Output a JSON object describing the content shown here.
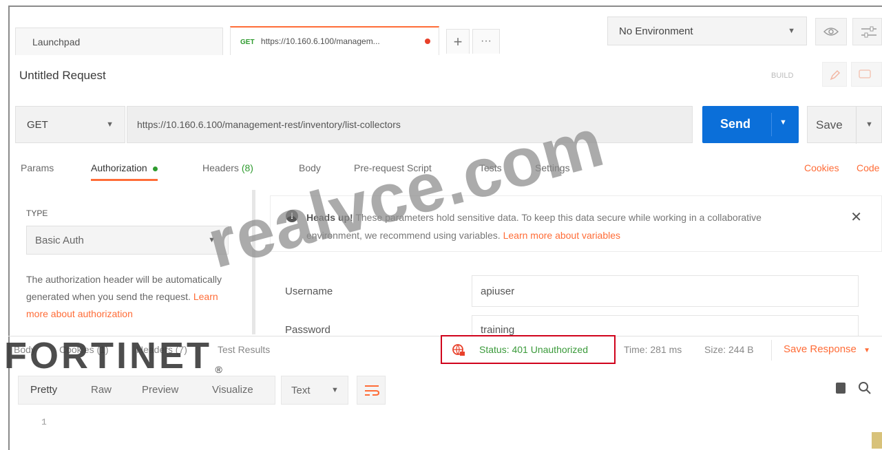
{
  "tabs": {
    "launchpad": "Launchpad",
    "request_method": "GET",
    "request_url": "https://10.160.6.100/managem...",
    "add": "+",
    "more": "···"
  },
  "environment": {
    "selected": "No Environment"
  },
  "request": {
    "title": "Untitled Request",
    "build_label": "BUILD",
    "method": "GET",
    "url": "https://10.160.6.100/management-rest/inventory/list-collectors",
    "send_label": "Send",
    "save_label": "Save"
  },
  "request_tabs": {
    "params": "Params",
    "authorization": "Authorization",
    "headers": "Headers",
    "headers_count": "(8)",
    "body": "Body",
    "prerequest": "Pre-request Script",
    "tests": "Tests",
    "settings": "Settings",
    "cookies": "Cookies",
    "code": "Code"
  },
  "auth": {
    "type_label": "TYPE",
    "type_value": "Basic Auth",
    "description": "The authorization header will be automatically generated when you send the request.",
    "learn_more": "Learn more about authorization",
    "warning_prefix": "Heads up!",
    "warning_text": "These parameters hold sensitive data. To keep this data secure while working in a collaborative environment, we recommend using variables.",
    "warning_link": "Learn more about variables",
    "username_label": "Username",
    "username_value": "apiuser",
    "password_label": "Password",
    "password_value": "training"
  },
  "response": {
    "tab_body": "Body",
    "tab_cookies": "Cookies (1)",
    "tab_headers": "Headers (7)",
    "tab_tests": "Test Results",
    "status": "Status: 401 Unauthorized",
    "time": "Time: 281 ms",
    "size": "Size: 244 B",
    "save_response": "Save Response",
    "view_pretty": "Pretty",
    "view_raw": "Raw",
    "view_preview": "Preview",
    "view_visualize": "Visualize",
    "format": "Text",
    "line_number": "1"
  },
  "watermarks": {
    "site": "realvce.com",
    "brand": "FORTINET",
    "registered": "®"
  },
  "colors": {
    "accent": "#ff6c37",
    "send_blue": "#0b6fd9",
    "status_green": "#3a9a3a",
    "highlight_red": "#d0021b",
    "watermark_gray": "#8c8c8c",
    "brand_dark": "#3a3a3a"
  }
}
